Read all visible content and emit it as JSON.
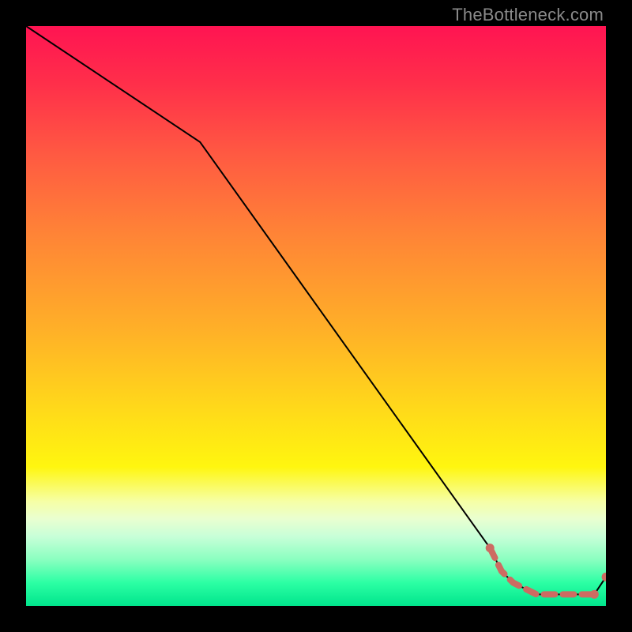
{
  "watermark": "TheBottleneck.com",
  "colors": {
    "line_main": "#000000",
    "line_accent": "#cd6b62",
    "dot_accent": "#cd6b62"
  },
  "chart_data": {
    "type": "line",
    "title": "",
    "xlabel": "",
    "ylabel": "",
    "xlim": [
      0,
      100
    ],
    "ylim": [
      0,
      100
    ],
    "series": [
      {
        "name": "main",
        "style": "solid-thin-black",
        "x": [
          0,
          30,
          80,
          82,
          84,
          86,
          88,
          90,
          92,
          94,
          96,
          98,
          100
        ],
        "y": [
          100,
          80,
          10,
          6,
          4,
          3,
          2,
          2,
          2,
          2,
          2,
          2,
          5
        ]
      },
      {
        "name": "highlight-dashed",
        "style": "dashed-thick-accent",
        "x": [
          80,
          82,
          84,
          86,
          88,
          90,
          92,
          94,
          96,
          98
        ],
        "y": [
          10,
          6,
          4,
          3,
          2,
          2,
          2,
          2,
          2,
          2
        ]
      },
      {
        "name": "highlight-points",
        "style": "points-accent",
        "x": [
          80,
          98,
          100
        ],
        "y": [
          10,
          2,
          5
        ]
      }
    ]
  }
}
